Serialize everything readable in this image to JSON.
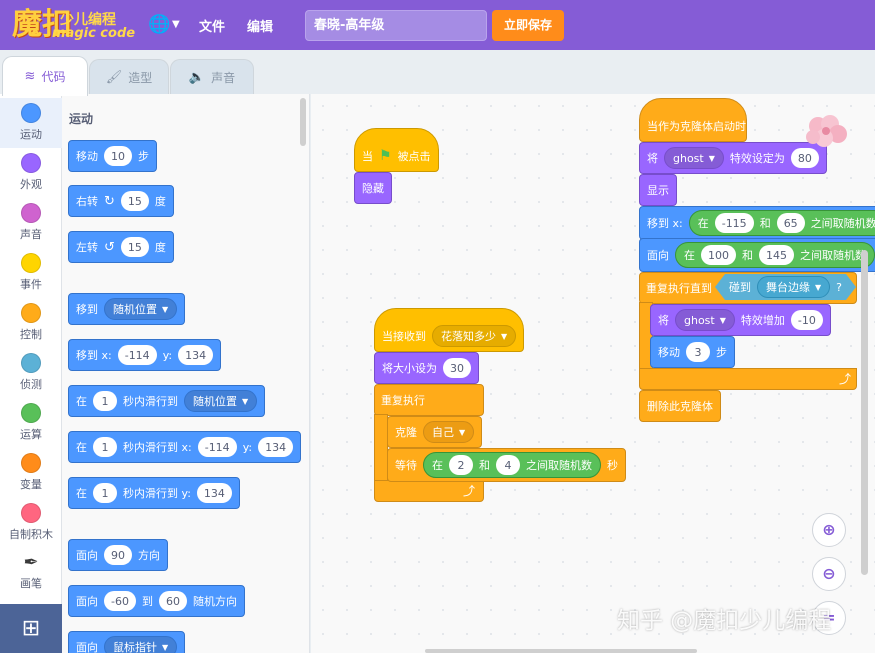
{
  "menubar": {
    "logo_char": "魔扣",
    "logo_cn": "少儿编程",
    "logo_en": "magic code",
    "file": "文件",
    "edit": "编辑",
    "project_title": "春晓-高年级",
    "save": "立即保存"
  },
  "tabs": [
    {
      "label": "代码"
    },
    {
      "label": "造型"
    },
    {
      "label": "声音"
    }
  ],
  "categories": [
    {
      "label": "运动",
      "color": "#4c97ff"
    },
    {
      "label": "外观",
      "color": "#9966ff"
    },
    {
      "label": "声音",
      "color": "#cf63cf"
    },
    {
      "label": "事件",
      "color": "#ffd500"
    },
    {
      "label": "控制",
      "color": "#ffab19"
    },
    {
      "label": "侦测",
      "color": "#5cb1d6"
    },
    {
      "label": "运算",
      "color": "#59c059"
    },
    {
      "label": "变量",
      "color": "#ff8c1a"
    },
    {
      "label": "自制积木",
      "color": "#ff6680"
    },
    {
      "label": "画笔",
      "icon": "pen-icon"
    }
  ],
  "palette": {
    "title": "运动",
    "move": {
      "a": "移动",
      "n": "10",
      "b": "步"
    },
    "turn_right": {
      "a": "右转",
      "n": "15",
      "b": "度"
    },
    "turn_left": {
      "a": "左转",
      "n": "15",
      "b": "度"
    },
    "goto": {
      "a": "移到",
      "opt": "随机位置"
    },
    "goto_xy": {
      "a": "移到 x:",
      "x": "-114",
      "b": "y:",
      "y": "134"
    },
    "glide": {
      "a": "在",
      "n": "1",
      "b": "秒内滑行到",
      "opt": "随机位置"
    },
    "glide_xy": {
      "a": "在",
      "n": "1",
      "b": "秒内滑行到 x:",
      "x": "-114",
      "c": "y:",
      "y": "134"
    },
    "glide_y": {
      "a": "在",
      "n": "1",
      "b": "秒内滑行到 y:",
      "y": "134"
    },
    "point": {
      "a": "面向",
      "n": "90",
      "b": "方向"
    },
    "point_random": {
      "a": "面向",
      "n1": "-60",
      "b": "到",
      "n2": "60",
      "c": "随机方向"
    },
    "point_toward": {
      "a": "面向",
      "opt": "鼠标指针"
    }
  },
  "script1": {
    "hat_a": "当",
    "hat_b": "被点击",
    "hide": "隐藏"
  },
  "script2": {
    "hat": "当接收到",
    "msg": "花落知多少",
    "size_a": "将大小设为",
    "size_n": "30",
    "forever": "重复执行",
    "clone_a": "克隆",
    "clone_opt": "自己",
    "wait_a": "等待",
    "op_a": "在",
    "op_n1": "2",
    "op_b": "和",
    "op_n2": "4",
    "op_c": "之间取随机数",
    "wait_b": "秒"
  },
  "script3": {
    "hat": "当作为克隆体启动时",
    "effect_a": "将",
    "effect_opt": "ghost",
    "effect_b": "特效设定为",
    "effect_n": "80",
    "show": "显示",
    "goto_a": "移到 x:",
    "op1_a": "在",
    "op1_n1": "-115",
    "op1_b": "和",
    "op1_n2": "65",
    "op1_c": "之间取随机数",
    "point_a": "面向",
    "op2_a": "在",
    "op2_n1": "100",
    "op2_b": "和",
    "op2_n2": "145",
    "op2_c": "之间取随机数",
    "repeat_a": "重复执行直到",
    "touch_a": "碰到",
    "touch_opt": "舞台边缘",
    "touch_q": "?",
    "change_a": "将",
    "change_opt": "ghost",
    "change_b": "特效增加",
    "change_n": "-10",
    "move_a": "移动",
    "move_n": "3",
    "move_b": "步",
    "delete": "删除此克隆体"
  },
  "watermark": "知乎 @魔扣少儿编程"
}
